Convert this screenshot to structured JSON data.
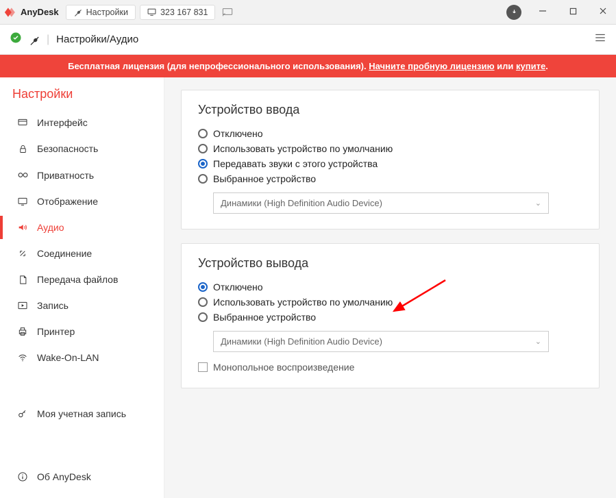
{
  "title_bar": {
    "app_name": "AnyDesk",
    "tab1_label": "Настройки",
    "tab2_label": "323 167 831"
  },
  "breadcrumb": {
    "text": "Настройки/Аудио"
  },
  "banner": {
    "part1": "Бесплатная лицензия (для непрофессионального использования). ",
    "link1": "Начните пробную лицензию",
    "part2": " или ",
    "link2": "купите",
    "part3": "."
  },
  "sidebar": {
    "title": "Настройки",
    "items": [
      {
        "label": "Интерфейс"
      },
      {
        "label": "Безопасность"
      },
      {
        "label": "Приватность"
      },
      {
        "label": "Отображение"
      },
      {
        "label": "Аудио"
      },
      {
        "label": "Соединение"
      },
      {
        "label": "Передача файлов"
      },
      {
        "label": "Запись"
      },
      {
        "label": "Принтер"
      },
      {
        "label": "Wake-On-LAN"
      }
    ],
    "bottom": [
      {
        "label": "Моя учетная запись"
      },
      {
        "label": "Об AnyDesk"
      }
    ]
  },
  "input_device": {
    "title": "Устройство ввода",
    "options": [
      "Отключено",
      "Использовать устройство по умолчанию",
      "Передавать звуки с этого устройства",
      "Выбранное устройство"
    ],
    "selected_index": 2,
    "device": "Динамики (High Definition Audio Device)"
  },
  "output_device": {
    "title": "Устройство вывода",
    "options": [
      "Отключено",
      "Использовать устройство по умолчанию",
      "Выбранное устройство"
    ],
    "selected_index": 0,
    "device": "Динамики (High Definition Audio Device)",
    "checkbox_label": "Монопольное воспроизведение"
  }
}
